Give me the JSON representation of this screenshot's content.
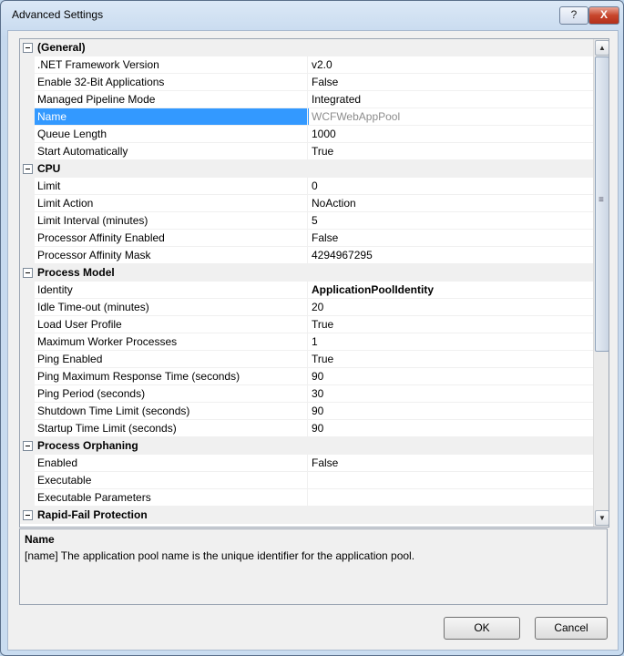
{
  "window": {
    "title": "Advanced Settings",
    "help_glyph": "?",
    "close_glyph": "X"
  },
  "grid": {
    "rows": [
      {
        "kind": "category",
        "label": "(General)"
      },
      {
        "kind": "property",
        "label": ".NET Framework Version",
        "value": "v2.0"
      },
      {
        "kind": "property",
        "label": "Enable 32-Bit Applications",
        "value": "False"
      },
      {
        "kind": "property",
        "label": "Managed Pipeline Mode",
        "value": "Integrated"
      },
      {
        "kind": "property",
        "label": "Name",
        "value": "WCFWebAppPool",
        "selected": true,
        "readonly": true
      },
      {
        "kind": "property",
        "label": "Queue Length",
        "value": "1000"
      },
      {
        "kind": "property",
        "label": "Start Automatically",
        "value": "True"
      },
      {
        "kind": "category",
        "label": "CPU"
      },
      {
        "kind": "property",
        "label": "Limit",
        "value": "0"
      },
      {
        "kind": "property",
        "label": "Limit Action",
        "value": "NoAction"
      },
      {
        "kind": "property",
        "label": "Limit Interval (minutes)",
        "value": "5"
      },
      {
        "kind": "property",
        "label": "Processor Affinity Enabled",
        "value": "False"
      },
      {
        "kind": "property",
        "label": "Processor Affinity Mask",
        "value": "4294967295"
      },
      {
        "kind": "category",
        "label": "Process Model"
      },
      {
        "kind": "property",
        "label": "Identity",
        "value": "ApplicationPoolIdentity",
        "bold": true
      },
      {
        "kind": "property",
        "label": "Idle Time-out (minutes)",
        "value": "20"
      },
      {
        "kind": "property",
        "label": "Load User Profile",
        "value": "True"
      },
      {
        "kind": "property",
        "label": "Maximum Worker Processes",
        "value": "1"
      },
      {
        "kind": "property",
        "label": "Ping Enabled",
        "value": "True"
      },
      {
        "kind": "property",
        "label": "Ping Maximum Response Time (seconds)",
        "value": "90"
      },
      {
        "kind": "property",
        "label": "Ping Period (seconds)",
        "value": "30"
      },
      {
        "kind": "property",
        "label": "Shutdown Time Limit (seconds)",
        "value": "90"
      },
      {
        "kind": "property",
        "label": "Startup Time Limit (seconds)",
        "value": "90"
      },
      {
        "kind": "category",
        "label": "Process Orphaning"
      },
      {
        "kind": "property",
        "label": "Enabled",
        "value": "False"
      },
      {
        "kind": "property",
        "label": "Executable",
        "value": ""
      },
      {
        "kind": "property",
        "label": "Executable Parameters",
        "value": ""
      },
      {
        "kind": "category",
        "label": "Rapid-Fail Protection"
      }
    ],
    "scroll_up_glyph": "▲",
    "scroll_down_glyph": "▼",
    "scroll_grip_glyph": "≡"
  },
  "description": {
    "title": "Name",
    "text": "[name] The application pool name is the unique identifier for the application pool."
  },
  "buttons": {
    "ok": "OK",
    "cancel": "Cancel"
  }
}
